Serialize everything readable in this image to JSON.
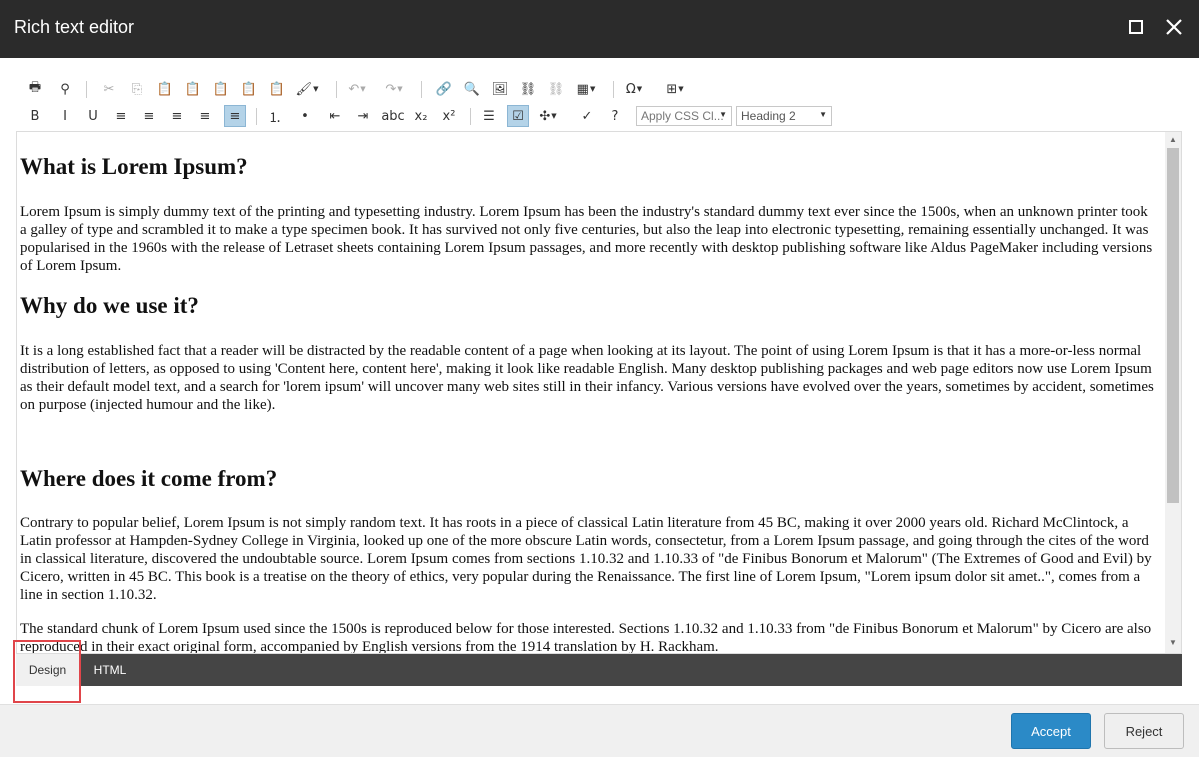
{
  "window": {
    "title": "Rich text editor"
  },
  "toolbar": {
    "row1": [
      {
        "icon": "print-icon",
        "glyph": "🖶"
      },
      {
        "icon": "find-icon",
        "glyph": "⚲"
      },
      {
        "icon": "cut-icon",
        "glyph": "✂",
        "dim": true
      },
      {
        "icon": "copy-icon",
        "glyph": "⎘",
        "dim": true
      },
      {
        "icon": "paste-icon",
        "glyph": "📋"
      },
      {
        "icon": "paste-text-icon",
        "glyph": "📋"
      },
      {
        "icon": "paste-word-icon",
        "glyph": "📋"
      },
      {
        "icon": "paste-html-icon",
        "glyph": "📋"
      },
      {
        "icon": "paste-format-icon",
        "glyph": "📋"
      },
      {
        "icon": "format-painter-icon",
        "glyph": "🖌",
        "caret": true
      },
      {
        "icon": "undo-icon",
        "glyph": "↶",
        "dim": true,
        "caret": true
      },
      {
        "icon": "redo-icon",
        "glyph": "↷",
        "dim": true,
        "caret": true
      },
      {
        "icon": "link-manager-icon",
        "glyph": "🔗"
      },
      {
        "icon": "link-icon",
        "glyph": "🔍"
      },
      {
        "icon": "image-icon",
        "glyph": "🖼"
      },
      {
        "icon": "insert-link-icon",
        "glyph": "⛓"
      },
      {
        "icon": "unlink-icon",
        "glyph": "⛓",
        "dim": true
      },
      {
        "icon": "table-icon",
        "glyph": "▦",
        "caret": true
      },
      {
        "icon": "symbol-icon",
        "glyph": "Ω",
        "caret": true
      },
      {
        "icon": "snippet-icon",
        "glyph": "⊞",
        "caret": true
      }
    ],
    "row2": [
      {
        "icon": "bold-icon",
        "glyph": "B"
      },
      {
        "icon": "italic-icon",
        "glyph": "I"
      },
      {
        "icon": "underline-icon",
        "glyph": "U"
      },
      {
        "icon": "align-left-icon",
        "glyph": "≡"
      },
      {
        "icon": "align-center-icon",
        "glyph": "≡"
      },
      {
        "icon": "align-right-icon",
        "glyph": "≡"
      },
      {
        "icon": "justify-icon",
        "glyph": "≡"
      },
      {
        "icon": "justify-none-icon",
        "glyph": "≡",
        "active": true
      },
      {
        "icon": "numbered-list-icon",
        "glyph": "⒈"
      },
      {
        "icon": "bullet-list-icon",
        "glyph": "•"
      },
      {
        "icon": "outdent-icon",
        "glyph": "⇤"
      },
      {
        "icon": "indent-icon",
        "glyph": "⇥"
      },
      {
        "icon": "strikethrough-icon",
        "glyph": "abc"
      },
      {
        "icon": "subscript-icon",
        "glyph": "x₂"
      },
      {
        "icon": "superscript-icon",
        "glyph": "x²"
      },
      {
        "icon": "horizontal-rule-icon",
        "glyph": "☰"
      },
      {
        "icon": "design-view-icon",
        "glyph": "☑",
        "active": true
      },
      {
        "icon": "module-icon",
        "glyph": "✣",
        "caret": true
      },
      {
        "icon": "spellcheck-icon",
        "glyph": "✓"
      },
      {
        "icon": "help-icon",
        "glyph": "?"
      }
    ],
    "css_dropdown": {
      "label": "Apply CSS Cl..."
    },
    "format_dropdown": {
      "label": "Heading 2"
    }
  },
  "content": {
    "h1": "What is Lorem Ipsum?",
    "p1": "Lorem Ipsum is simply dummy text of the printing and typesetting industry. Lorem Ipsum has been the industry's standard dummy text ever since the 1500s, when an unknown printer took a galley of type and scrambled it to make a type specimen book. It has survived not only five centuries, but also the leap into electronic typesetting, remaining essentially unchanged. It was popularised in the 1960s with the release of Letraset sheets containing Lorem Ipsum passages, and more recently with desktop publishing software like Aldus PageMaker including versions of Lorem Ipsum.",
    "h2": "Why do we use it?",
    "p2": "It is a long established fact that a reader will be distracted by the readable content of a page when looking at its layout. The point of using Lorem Ipsum is that it has a more-or-less normal distribution of letters, as opposed to using 'Content here, content here', making it look like readable English. Many desktop publishing packages and web page editors now use Lorem Ipsum as their default model text, and a search for 'lorem ipsum' will uncover many web sites still in their infancy. Various versions have evolved over the years, sometimes by accident, sometimes on purpose (injected humour and the like).",
    "h3": "Where does it come from?",
    "p3": "Contrary to popular belief, Lorem Ipsum is not simply random text. It has roots in a piece of classical Latin literature from 45 BC, making it over 2000 years old. Richard McClintock, a Latin professor at Hampden-Sydney College in Virginia, looked up one of the more obscure Latin words, consectetur, from a Lorem Ipsum passage, and going through the cites of the word in classical literature, discovered the undoubtable source. Lorem Ipsum comes from sections 1.10.32 and 1.10.33 of \"de Finibus Bonorum et Malorum\" (The Extremes of Good and Evil) by Cicero, written in 45 BC. This book is a treatise on the theory of ethics, very popular during the Renaissance. The first line of Lorem Ipsum, \"Lorem ipsum dolor sit amet..\", comes from a line in section 1.10.32.",
    "p4": "The standard chunk of Lorem Ipsum used since the 1500s is reproduced below for those interested. Sections 1.10.32 and 1.10.33 from \"de Finibus Bonorum et Malorum\" by Cicero are also reproduced in their exact original form, accompanied by English versions from the 1914 translation by H. Rackham."
  },
  "modes": {
    "design": "Design",
    "html": "HTML"
  },
  "footer": {
    "accept": "Accept",
    "reject": "Reject"
  },
  "colors": {
    "accent": "#2b8ac7",
    "titlebar": "#2b2b2b",
    "highlight": "#e0454a"
  }
}
